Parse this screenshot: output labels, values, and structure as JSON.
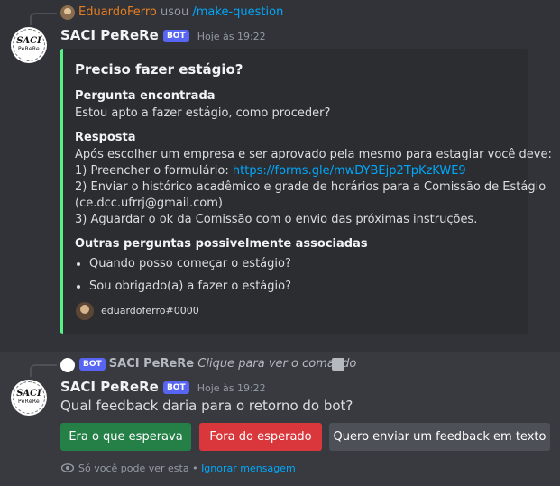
{
  "msg1": {
    "reply_user": "EduardoFerro",
    "reply_used": "usou",
    "reply_command": "/make-question",
    "author": "SACI PeReRe",
    "bot_tag": "BOT",
    "timestamp": "Hoje às 19:22",
    "avatar_line1": "SACI",
    "avatar_line2": "PeReRe"
  },
  "embed": {
    "title": "Preciso fazer estágio?",
    "field1_name": "Pergunta encontrada",
    "field1_value": "Estou apto a fazer estágio, como proceder?",
    "field2_name": "Resposta",
    "answer_line1": "Após escolher um empresa e ser aprovado pela mesmo para estagiar você deve:",
    "answer_line2_prefix": "1) Preencher o formulário: ",
    "answer_link": "https://forms.gle/mwDYBEjp2TpKzKWE9",
    "answer_line3": "2) Enviar o histórico acadêmico e grade de horários para a Comissão de Estágio",
    "answer_line4": "(ce.dcc.ufrrj@gmail.com)",
    "answer_line5": "3) Aguardar o ok da Comissão com o envio das próximas instruções.",
    "field3_name": "Outras perguntas possivelmente associadas",
    "related": [
      "Quando posso começar o estágio?",
      "Sou obrigado(a) a fazer o estágio?"
    ],
    "footer": "eduardoferro#0000",
    "accent_color": "#57f287"
  },
  "msg2": {
    "reply_bot_tag": "BOT",
    "reply_author": "SACI PeReRe",
    "reply_hint": "Clique para ver o comando",
    "author": "SACI PeReRe",
    "bot_tag": "BOT",
    "timestamp": "Hoje às 19:22",
    "avatar_line1": "SACI",
    "avatar_line2": "PeReRe",
    "content": "Qual feedback daria para o retorno do bot?",
    "buttons": [
      {
        "label": "Era o que esperava",
        "color": "#248046"
      },
      {
        "label": "Fora do esperado",
        "color": "#da373c"
      },
      {
        "label": "Quero enviar um feedback em texto",
        "color": "#4e5058"
      }
    ],
    "ephemeral_note": "Só você pode ver esta •",
    "dismiss_link": "Ignorar mensagem"
  }
}
